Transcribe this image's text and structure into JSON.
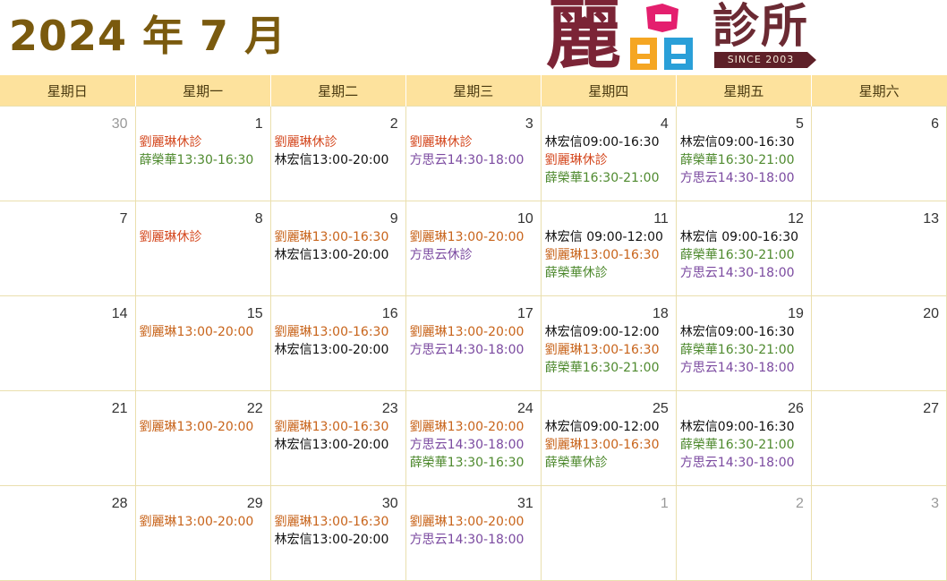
{
  "header": {
    "title": "2024 年 7 月",
    "logo_char": "麗",
    "clinic_name": "診所",
    "since": "SINCE 2003"
  },
  "weekdays": [
    "星期日",
    "星期一",
    "星期二",
    "星期三",
    "星期四",
    "星期五",
    "星期六"
  ],
  "colors": {
    "title": "#7a5a0e",
    "header_bg": "#fde29d",
    "liu": "#c8641b",
    "lin": "#111111",
    "xue": "#4f8a2f",
    "fang": "#7b4aa0"
  },
  "weeks": [
    [
      {
        "day": "30",
        "muted": true,
        "entries": []
      },
      {
        "day": "1",
        "entries": [
          {
            "text": "劉麗琳休診",
            "who": "liu-off"
          },
          {
            "text": "薛榮華13:30-16:30",
            "who": "xue"
          }
        ]
      },
      {
        "day": "2",
        "entries": [
          {
            "text": "劉麗琳休診",
            "who": "liu-off"
          },
          {
            "text": "林宏信13:00-20:00",
            "who": "lin"
          }
        ]
      },
      {
        "day": "3",
        "entries": [
          {
            "text": "劉麗琳休診",
            "who": "liu-off"
          },
          {
            "text": "方思云14:30-18:00",
            "who": "fang"
          }
        ]
      },
      {
        "day": "4",
        "entries": [
          {
            "text": "林宏信09:00-16:30",
            "who": "lin"
          },
          {
            "text": "劉麗琳休診",
            "who": "liu-off"
          },
          {
            "text": "薛榮華16:30-21:00",
            "who": "xue"
          }
        ]
      },
      {
        "day": "5",
        "entries": [
          {
            "text": "林宏信09:00-16:30",
            "who": "lin"
          },
          {
            "text": "薛榮華16:30-21:00",
            "who": "xue"
          },
          {
            "text": "方思云14:30-18:00",
            "who": "fang"
          }
        ]
      },
      {
        "day": "6",
        "entries": []
      }
    ],
    [
      {
        "day": "7",
        "entries": []
      },
      {
        "day": "8",
        "entries": [
          {
            "text": "劉麗琳休診",
            "who": "liu-off"
          }
        ]
      },
      {
        "day": "9",
        "entries": [
          {
            "text": "劉麗琳13:00-16:30",
            "who": "liu"
          },
          {
            "text": "林宏信13:00-20:00",
            "who": "lin"
          }
        ]
      },
      {
        "day": "10",
        "entries": [
          {
            "text": "劉麗琳13:00-20:00",
            "who": "liu"
          },
          {
            "text": "方思云休診",
            "who": "fang"
          }
        ]
      },
      {
        "day": "11",
        "entries": [
          {
            "text": "林宏信 09:00-12:00",
            "who": "lin"
          },
          {
            "text": "劉麗琳13:00-16:30",
            "who": "liu"
          },
          {
            "text": "薛榮華休診",
            "who": "xue"
          }
        ]
      },
      {
        "day": "12",
        "entries": [
          {
            "text": "林宏信 09:00-16:30",
            "who": "lin"
          },
          {
            "text": "薛榮華16:30-21:00",
            "who": "xue"
          },
          {
            "text": "方思云14:30-18:00",
            "who": "fang"
          }
        ]
      },
      {
        "day": "13",
        "entries": []
      }
    ],
    [
      {
        "day": "14",
        "entries": []
      },
      {
        "day": "15",
        "entries": [
          {
            "text": "劉麗琳13:00-20:00",
            "who": "liu"
          }
        ]
      },
      {
        "day": "16",
        "entries": [
          {
            "text": "劉麗琳13:00-16:30",
            "who": "liu"
          },
          {
            "text": "林宏信13:00-20:00",
            "who": "lin"
          }
        ]
      },
      {
        "day": "17",
        "entries": [
          {
            "text": "劉麗琳13:00-20:00",
            "who": "liu"
          },
          {
            "text": "方思云14:30-18:00",
            "who": "fang"
          }
        ]
      },
      {
        "day": "18",
        "entries": [
          {
            "text": "林宏信09:00-12:00",
            "who": "lin"
          },
          {
            "text": "劉麗琳13:00-16:30",
            "who": "liu"
          },
          {
            "text": "薛榮華16:30-21:00",
            "who": "xue"
          }
        ]
      },
      {
        "day": "19",
        "entries": [
          {
            "text": "林宏信09:00-16:30",
            "who": "lin"
          },
          {
            "text": "薛榮華16:30-21:00",
            "who": "xue"
          },
          {
            "text": "方思云14:30-18:00",
            "who": "fang"
          }
        ]
      },
      {
        "day": "20",
        "entries": []
      }
    ],
    [
      {
        "day": "21",
        "entries": []
      },
      {
        "day": "22",
        "entries": [
          {
            "text": "劉麗琳13:00-20:00",
            "who": "liu"
          }
        ]
      },
      {
        "day": "23",
        "entries": [
          {
            "text": "劉麗琳13:00-16:30",
            "who": "liu"
          },
          {
            "text": "林宏信13:00-20:00",
            "who": "lin"
          }
        ]
      },
      {
        "day": "24",
        "entries": [
          {
            "text": "劉麗琳13:00-20:00",
            "who": "liu"
          },
          {
            "text": "方思云14:30-18:00",
            "who": "fang"
          },
          {
            "text": "薛榮華13:30-16:30",
            "who": "xue"
          }
        ]
      },
      {
        "day": "25",
        "entries": [
          {
            "text": "林宏信09:00-12:00",
            "who": "lin"
          },
          {
            "text": "劉麗琳13:00-16:30",
            "who": "liu"
          },
          {
            "text": "薛榮華休診",
            "who": "xue"
          }
        ]
      },
      {
        "day": "26",
        "entries": [
          {
            "text": "林宏信09:00-16:30",
            "who": "lin"
          },
          {
            "text": "薛榮華16:30-21:00",
            "who": "xue"
          },
          {
            "text": "方思云14:30-18:00",
            "who": "fang"
          }
        ]
      },
      {
        "day": "27",
        "entries": []
      }
    ],
    [
      {
        "day": "28",
        "entries": []
      },
      {
        "day": "29",
        "entries": [
          {
            "text": "劉麗琳13:00-20:00",
            "who": "liu"
          }
        ]
      },
      {
        "day": "30",
        "entries": [
          {
            "text": "劉麗琳13:00-16:30",
            "who": "liu"
          },
          {
            "text": "林宏信13:00-20:00",
            "who": "lin"
          }
        ]
      },
      {
        "day": "31",
        "entries": [
          {
            "text": "劉麗琳13:00-20:00",
            "who": "liu"
          },
          {
            "text": "方思云14:30-18:00",
            "who": "fang"
          }
        ]
      },
      {
        "day": "1",
        "muted": true,
        "entries": []
      },
      {
        "day": "2",
        "muted": true,
        "entries": []
      },
      {
        "day": "3",
        "muted": true,
        "entries": []
      }
    ]
  ]
}
